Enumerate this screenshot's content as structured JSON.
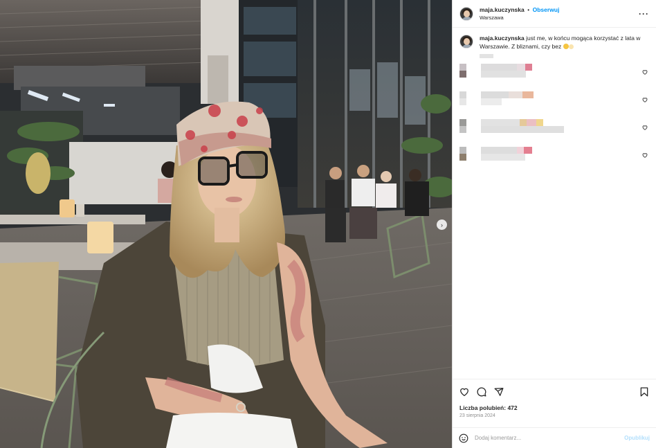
{
  "post": {
    "username": "maja.kuczynska",
    "follow_label": "Obserwuj",
    "separator": "•",
    "location": "Warszawa",
    "more_label": "···",
    "caption_text": "just me, w końcu mogąca korzystać z lata w Warszawie. Z bliznami, czy bez"
  },
  "comments": [
    {
      "colors": [
        "#c7c0c4",
        "#7e6e6e"
      ],
      "bars": [
        [
          "#dddcdd",
          52
        ],
        [
          "#e8dde1",
          12
        ],
        [
          "#df7f93",
          10
        ]
      ],
      "bars2": [
        [
          "#e1e1e1",
          65
        ]
      ]
    },
    {
      "colors": [
        "#d8d8d8",
        "#e7e7e7"
      ],
      "bars": [
        [
          "#dcdcdc",
          40
        ],
        [
          "#e9dfdb",
          20
        ],
        [
          "#e9b79c",
          16
        ]
      ],
      "bars2": [
        [
          "#ececec",
          30
        ]
      ]
    },
    {
      "colors": [
        "#9a9a98",
        "#c4c4c4"
      ],
      "bars": [
        [
          "#e2e2e2",
          56
        ],
        [
          "#e5c99a",
          10
        ],
        [
          "#ebbfc3",
          14
        ],
        [
          "#f0d68c",
          10
        ]
      ],
      "bars2": [
        [
          "#dfdfdf",
          120
        ]
      ]
    },
    {
      "colors": [
        "#bcbcbc",
        "#8d7e6c"
      ],
      "bars": [
        [
          "#dddddd",
          52
        ],
        [
          "#f1d2d9",
          10
        ],
        [
          "#e47f90",
          12
        ]
      ],
      "bars2": [
        [
          "#e6e6e6",
          64
        ]
      ]
    }
  ],
  "actions": {
    "likes_label": "Liczba polubień:",
    "likes_count": "472",
    "date": "23 sierpnia 2024",
    "comment_placeholder": "Dodaj komentarz...",
    "post_label": "Opublikuj"
  },
  "colors": {
    "accent": "#0095f6",
    "post_disabled": "#b2dffc",
    "muted": "#8e8e8e"
  },
  "icons": {
    "like": "heart-icon",
    "comment": "comment-icon",
    "share": "share-icon",
    "save": "bookmark-icon",
    "emoji": "smiley-icon",
    "next": "chevron-right-icon",
    "more": "ellipsis-icon"
  }
}
